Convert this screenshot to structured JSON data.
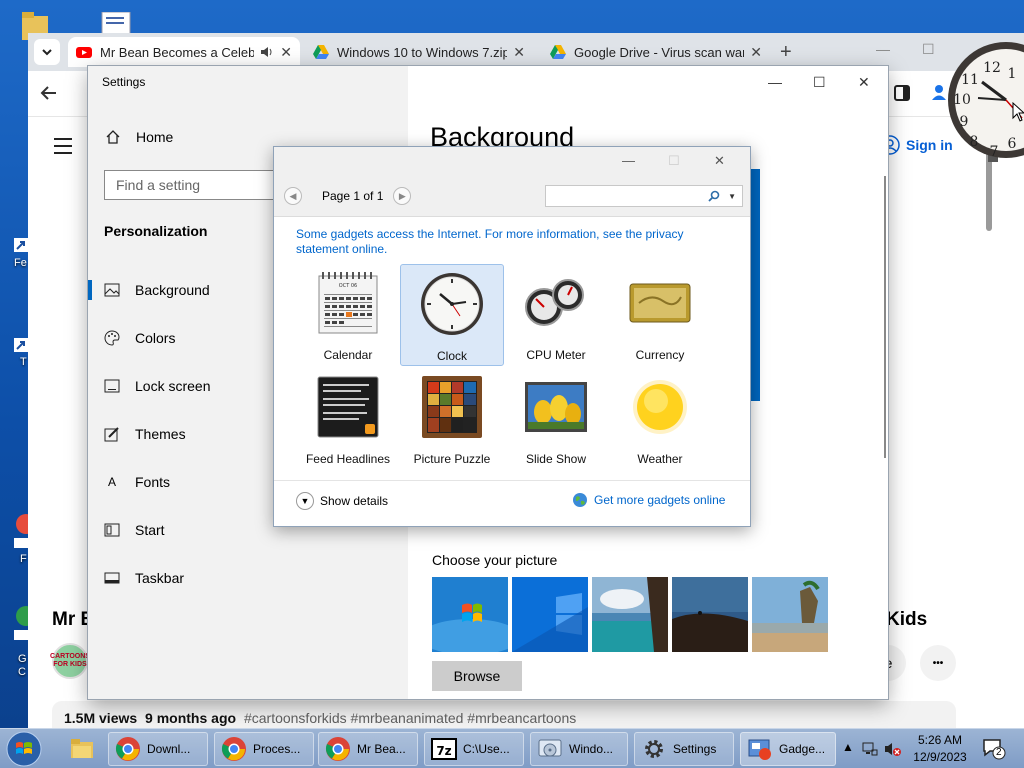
{
  "chrome": {
    "tabs": [
      {
        "title": "Mr Bean Becomes a Celeb",
        "icon": "youtube-icon",
        "active": true
      },
      {
        "title": "Windows 10 to Windows 7.zip",
        "icon": "google-drive-icon",
        "active": false
      },
      {
        "title": "Google Drive - Virus scan warn",
        "icon": "google-drive-icon",
        "active": false
      }
    ],
    "new_tab": "+",
    "sign_in": "Sign in",
    "video_title_left": "Mr Be",
    "video_title_right": "Kids",
    "avatar_text": "CARTOONS FOR KIDS",
    "share_label": "re",
    "more_label": "•••",
    "views": "1.5M views",
    "age": "9 months ago",
    "hashtags": "#cartoonsforkids #mrbeananimated #mrbeancartoons"
  },
  "settings": {
    "window_title": "Settings",
    "home": "Home",
    "search_placeholder": "Find a setting",
    "group": "Personalization",
    "nav": [
      {
        "label": "Background",
        "icon": "picture-icon",
        "selected": true
      },
      {
        "label": "Colors",
        "icon": "palette-icon",
        "selected": false
      },
      {
        "label": "Lock screen",
        "icon": "lock-screen-icon",
        "selected": false
      },
      {
        "label": "Themes",
        "icon": "themes-icon",
        "selected": false
      },
      {
        "label": "Fonts",
        "icon": "fonts-icon",
        "selected": false
      },
      {
        "label": "Start",
        "icon": "start-icon",
        "selected": false
      },
      {
        "label": "Taskbar",
        "icon": "taskbar-icon",
        "selected": false
      }
    ],
    "heading": "Background",
    "choose_picture": "Choose your picture",
    "browse": "Browse"
  },
  "gadgets": {
    "page_label": "Page 1 of 1",
    "notice": "Some gadgets access the Internet.  For more information, see the privacy statement online.",
    "items": [
      {
        "name": "Calendar",
        "icon": "calendar-gadget-icon",
        "selected": false
      },
      {
        "name": "Clock",
        "icon": "clock-gadget-icon",
        "selected": true
      },
      {
        "name": "CPU Meter",
        "icon": "cpu-meter-gadget-icon",
        "selected": false
      },
      {
        "name": "Currency",
        "icon": "currency-gadget-icon",
        "selected": false
      },
      {
        "name": "Feed Headlines",
        "icon": "feed-headlines-gadget-icon",
        "selected": false
      },
      {
        "name": "Picture Puzzle",
        "icon": "picture-puzzle-gadget-icon",
        "selected": false
      },
      {
        "name": "Slide Show",
        "icon": "slide-show-gadget-icon",
        "selected": false
      },
      {
        "name": "Weather",
        "icon": "weather-gadget-icon",
        "selected": false
      }
    ],
    "calendar_month": "OCT 06",
    "show_details": "Show details",
    "get_more": "Get more gadgets online"
  },
  "taskbar": {
    "items": [
      {
        "label": "Downl...",
        "icon": "chrome-icon"
      },
      {
        "label": "Proces...",
        "icon": "chrome-icon"
      },
      {
        "label": "Mr Bea...",
        "icon": "chrome-icon"
      },
      {
        "label": "C:\\Use...",
        "icon": "7zip-icon"
      },
      {
        "label": "Windo...",
        "icon": "installer-icon"
      },
      {
        "label": "Settings",
        "icon": "gear-icon"
      },
      {
        "label": "Gadge...",
        "icon": "gadgets-icon"
      }
    ],
    "time": "5:26 AM",
    "date": "12/9/2023",
    "notification_count": "2"
  },
  "colors": {
    "accent": "#0067c0",
    "link": "#0066cc",
    "youtube_red": "#ff0000"
  }
}
